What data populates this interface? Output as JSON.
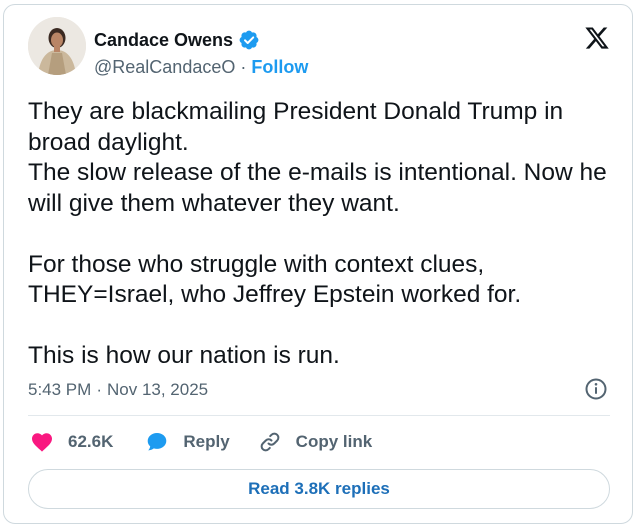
{
  "author": {
    "name": "Candace Owens",
    "handle": "@RealCandaceO",
    "separator": "·",
    "follow_label": "Follow",
    "verified": true
  },
  "brand": {
    "logo_icon": "x-logo-icon"
  },
  "tweet": {
    "text": "They are blackmailing President Donald Trump in broad daylight.\nThe slow release of the e-mails is intentional. Now he will give them whatever they want.\n\nFor those who struggle with context clues, THEY=Israel, who Jeffrey Epstein worked for.\n\nThis is how our nation is run.",
    "time": "5:43 PM",
    "date_separator": "·",
    "date": "Nov 13, 2025"
  },
  "actions": {
    "like_count": "62.6K",
    "reply_label": "Reply",
    "copy_label": "Copy link",
    "read_replies_label": "Read 3.8K replies"
  },
  "colors": {
    "accent": "#1d9bf0",
    "like": "#f91880",
    "text": "#0f1419",
    "muted": "#536471",
    "border": "#cfd9de"
  }
}
